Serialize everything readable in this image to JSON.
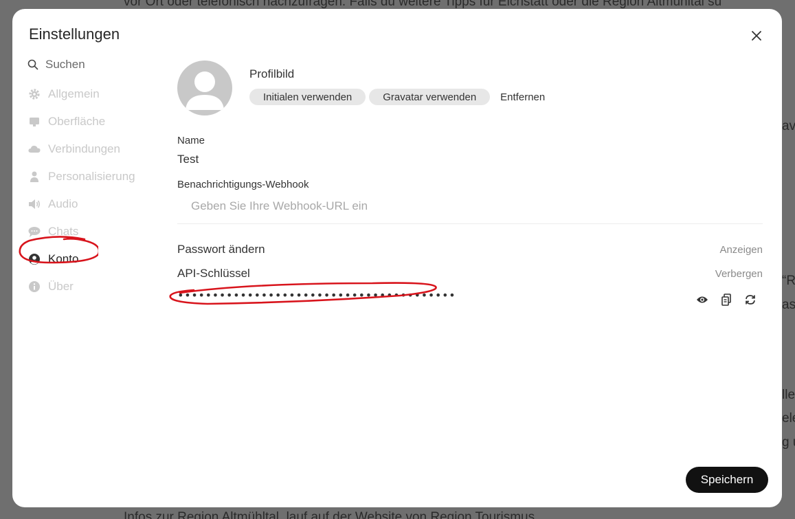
{
  "background": {
    "top_line": "vor Ort oder telefonisch nachzufragen. Falls du weitere Tipps für Eichstätt oder die Region Altmühltal su",
    "bottom_line": "Infos zur Region Altmühltal, lauf auf der Website von Region Tourismus",
    "right_fragments": [
      "av",
      "“R",
      "as",
      "lle",
      "ele",
      "g u"
    ]
  },
  "modal": {
    "title": "Einstellungen",
    "close_label": "×"
  },
  "sidebar": {
    "search_placeholder": "Suchen",
    "items": [
      {
        "label": "Allgemein",
        "icon": "gear-icon",
        "active": false
      },
      {
        "label": "Oberfläche",
        "icon": "monitor-icon",
        "active": false
      },
      {
        "label": "Verbindungen",
        "icon": "cloud-icon",
        "active": false
      },
      {
        "label": "Personalisierung",
        "icon": "person-icon",
        "active": false
      },
      {
        "label": "Audio",
        "icon": "speaker-icon",
        "active": false
      },
      {
        "label": "Chats",
        "icon": "chat-icon",
        "active": false
      },
      {
        "label": "Konto",
        "icon": "user-circle-icon",
        "active": true
      },
      {
        "label": "Über",
        "icon": "info-icon",
        "active": false
      }
    ]
  },
  "account": {
    "profile_label": "Profilbild",
    "initials_button": "Initialen verwenden",
    "gravatar_button": "Gravatar verwenden",
    "remove_button": "Entfernen",
    "name_label": "Name",
    "name_value": "Test",
    "webhook_label": "Benachrichtigungs-Webhook",
    "webhook_placeholder": "Geben Sie Ihre Webhook-URL ein",
    "password_label": "Passwort ändern",
    "password_action": "Anzeigen",
    "api_label": "API-Schlüssel",
    "api_action": "Verbergen",
    "api_key_masked": "••••••••••••••••••••••••••••••••••••••••"
  },
  "save_button": "Speichern",
  "colors": {
    "annotation": "#d8141c",
    "save_bg": "#111111",
    "pill_bg": "#e7e7e7",
    "inactive_nav": "#c9c9c9"
  }
}
